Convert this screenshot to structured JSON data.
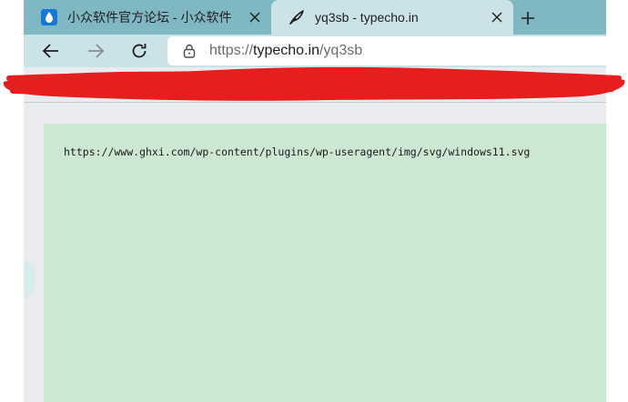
{
  "tabs": [
    {
      "title": "小众软件官方论坛 - 小众软件",
      "icon": "droplet-icon",
      "active": false
    },
    {
      "title": "yq3sb - typecho.in",
      "icon": "feather-icon",
      "active": true
    }
  ],
  "address": {
    "protocol": "https://",
    "host": "typecho.in",
    "path": "/yq3sb"
  },
  "content": {
    "text": "https://www.ghxi.com/wp-content/plugins/wp-useragent/img/svg/windows11.svg"
  },
  "colors": {
    "tabstrip": "#7fb7c2",
    "toolbar": "#cbe2e6",
    "content_bg": "#cde8d2",
    "redaction": "#e61e1e"
  }
}
